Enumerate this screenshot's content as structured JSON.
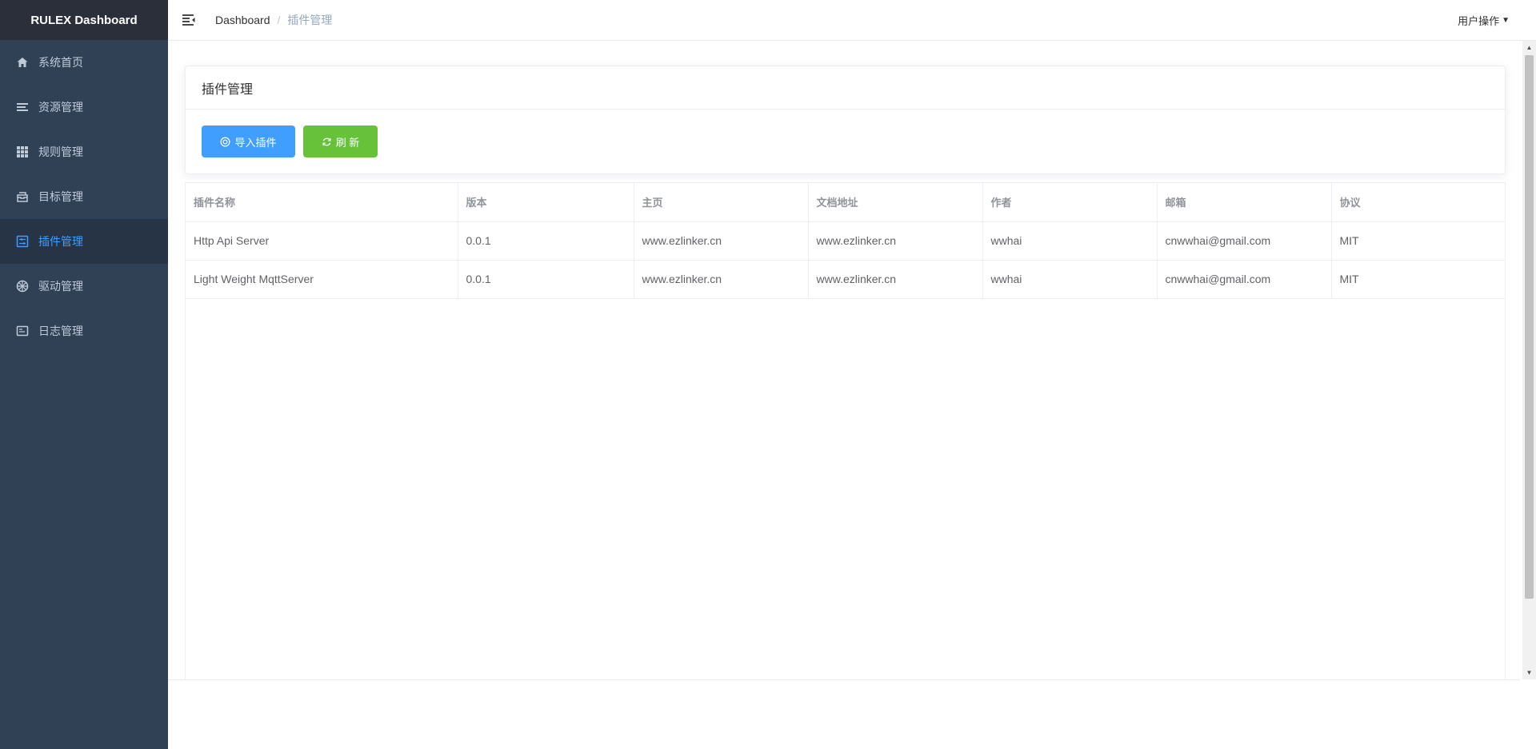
{
  "sidebar": {
    "brand": "RULEX Dashboard",
    "items": [
      {
        "label": "系统首页",
        "icon": "home-icon"
      },
      {
        "label": "资源管理",
        "icon": "list-icon"
      },
      {
        "label": "规则管理",
        "icon": "grid-icon"
      },
      {
        "label": "目标管理",
        "icon": "inbox-icon"
      },
      {
        "label": "插件管理",
        "icon": "plugin-icon",
        "active": true
      },
      {
        "label": "驱动管理",
        "icon": "wheel-icon"
      },
      {
        "label": "日志管理",
        "icon": "log-icon"
      }
    ]
  },
  "header": {
    "breadcrumb": {
      "home": "Dashboard",
      "separator": "/",
      "current": "插件管理"
    },
    "user_menu": "用户操作"
  },
  "card": {
    "title": "插件管理",
    "import_label": "导入插件",
    "refresh_label": "刷 新"
  },
  "table": {
    "columns": [
      "插件名称",
      "版本",
      "主页",
      "文档地址",
      "作者",
      "邮箱",
      "协议"
    ],
    "rows": [
      [
        "Http Api Server",
        "0.0.1",
        "www.ezlinker.cn",
        "www.ezlinker.cn",
        "wwhai",
        "cnwwhai@gmail.com",
        "MIT"
      ],
      [
        "Light Weight MqttServer",
        "0.0.1",
        "www.ezlinker.cn",
        "www.ezlinker.cn",
        "wwhai",
        "cnwwhai@gmail.com",
        "MIT"
      ]
    ]
  },
  "colors": {
    "sidebar_bg": "#304156",
    "accent": "#409eff",
    "success": "#67c23a"
  }
}
